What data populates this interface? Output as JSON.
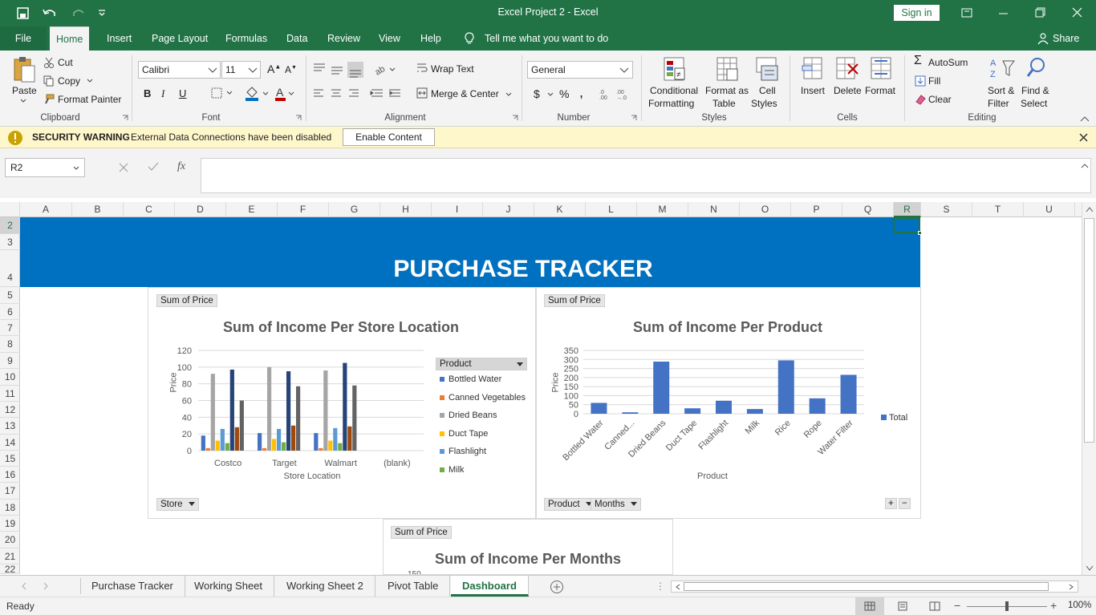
{
  "window": {
    "title": "Excel Project 2  -  Excel",
    "signin": "Sign in"
  },
  "menu": {
    "file": "File",
    "tabs": [
      "Home",
      "Insert",
      "Page Layout",
      "Formulas",
      "Data",
      "Review",
      "View",
      "Help"
    ],
    "tell": "Tell me what you want to do",
    "share": "Share"
  },
  "ribbon": {
    "clipboard": {
      "paste": "Paste",
      "cut": "Cut",
      "copy": "Copy",
      "format_painter": "Format Painter",
      "label": "Clipboard"
    },
    "font": {
      "name": "Calibri",
      "size": "11",
      "bold": "B",
      "italic": "I",
      "underline": "U",
      "label": "Font"
    },
    "alignment": {
      "wrap": "Wrap Text",
      "merge": "Merge & Center",
      "label": "Alignment"
    },
    "number": {
      "format": "General",
      "currency": "$",
      "percent": "%",
      "comma": ",",
      "label": "Number"
    },
    "styles": {
      "conditional": "Conditional",
      "conditional2": "Formatting",
      "format_as": "Format as",
      "format_as2": "Table",
      "cell": "Cell",
      "cell2": "Styles",
      "label": "Styles"
    },
    "cells": {
      "insert": "Insert",
      "delete": "Delete",
      "format": "Format",
      "label": "Cells"
    },
    "editing": {
      "autosum": "AutoSum",
      "fill": "Fill",
      "clear": "Clear",
      "sort": "Sort &",
      "sort2": "Filter",
      "find": "Find &",
      "find2": "Select",
      "label": "Editing"
    }
  },
  "security": {
    "title": "SECURITY WARNING",
    "message": "External Data Connections have been disabled",
    "button": "Enable Content"
  },
  "formula": {
    "namebox": "R2",
    "fx": "fx",
    "value": ""
  },
  "columns": [
    "A",
    "B",
    "C",
    "D",
    "E",
    "F",
    "G",
    "H",
    "I",
    "J",
    "K",
    "L",
    "M",
    "N",
    "O",
    "P",
    "Q",
    "R",
    "S",
    "T",
    "U"
  ],
  "rows": [
    "2",
    "3",
    "4",
    "5",
    "6",
    "7",
    "8",
    "9",
    "10",
    "11",
    "12",
    "13",
    "14",
    "15",
    "16",
    "17",
    "18",
    "19",
    "20",
    "21",
    "22"
  ],
  "banner": {
    "title": "PURCHASE TRACKER"
  },
  "chart1": {
    "field_top": "Sum of Price",
    "field_bottom": "Store",
    "legend_header": "Product",
    "yaxis_label": "Price",
    "xaxis_label": "Store Location"
  },
  "chart2": {
    "field_top": "Sum of Price",
    "field_bottom1": "Product",
    "field_bottom2": "Months",
    "legend": "Total",
    "yaxis_label": "Price",
    "xaxis_label": "Product"
  },
  "chart3": {
    "field_top": "Sum of Price",
    "tick_visible": "150"
  },
  "chart_data": [
    {
      "type": "bar",
      "title": "Sum of Income Per Store Location",
      "xlabel": "Store Location",
      "ylabel": "Price",
      "ylim": [
        0,
        120
      ],
      "yticks": [
        0,
        20,
        40,
        60,
        80,
        100,
        120
      ],
      "categories": [
        "Costco",
        "Target",
        "Walmart",
        "(blank)"
      ],
      "legend_position": "right",
      "series": [
        {
          "name": "Bottled Water",
          "color": "#4472c4",
          "values": [
            18,
            21,
            21,
            0
          ]
        },
        {
          "name": "Canned Vegetables",
          "color": "#ed7d31",
          "values": [
            3,
            3,
            3,
            0
          ]
        },
        {
          "name": "Dried Beans",
          "color": "#a5a5a5",
          "values": [
            92,
            100,
            96,
            0
          ]
        },
        {
          "name": "Duct Tape",
          "color": "#ffc000",
          "values": [
            12,
            14,
            12,
            0
          ]
        },
        {
          "name": "Flashlight",
          "color": "#5b9bd5",
          "values": [
            26,
            26,
            27,
            0
          ]
        },
        {
          "name": "Milk",
          "color": "#70ad47",
          "values": [
            9,
            10,
            9,
            0
          ]
        },
        {
          "name": "",
          "color": "#264478",
          "values": [
            97,
            95,
            105,
            0
          ]
        },
        {
          "name": "",
          "color": "#9e480e",
          "values": [
            28,
            30,
            29,
            0
          ]
        },
        {
          "name": "",
          "color": "#636363",
          "values": [
            60,
            77,
            78,
            0
          ]
        }
      ]
    },
    {
      "type": "bar",
      "title": "Sum of Income Per Product",
      "xlabel": "Product",
      "ylabel": "Price",
      "ylim": [
        0,
        350
      ],
      "yticks": [
        0,
        50,
        100,
        150,
        200,
        250,
        300,
        350
      ],
      "categories": [
        "Bottled Water",
        "Canned...",
        "Dried Beans",
        "Duct Tape",
        "Flashlight",
        "Milk",
        "Rice",
        "Rope",
        "Water Filter"
      ],
      "series": [
        {
          "name": "Total",
          "color": "#4472c4",
          "values": [
            60,
            8,
            288,
            30,
            72,
            26,
            295,
            85,
            215
          ]
        }
      ],
      "legend_position": "right"
    },
    {
      "type": "bar",
      "title": "Sum of Income Per Months"
    }
  ],
  "sheets": [
    "Purchase Tracker",
    "Working Sheet",
    "Working Sheet 2",
    "Pivot Table",
    "Dashboard"
  ],
  "status": {
    "ready": "Ready",
    "zoom": "100%"
  }
}
